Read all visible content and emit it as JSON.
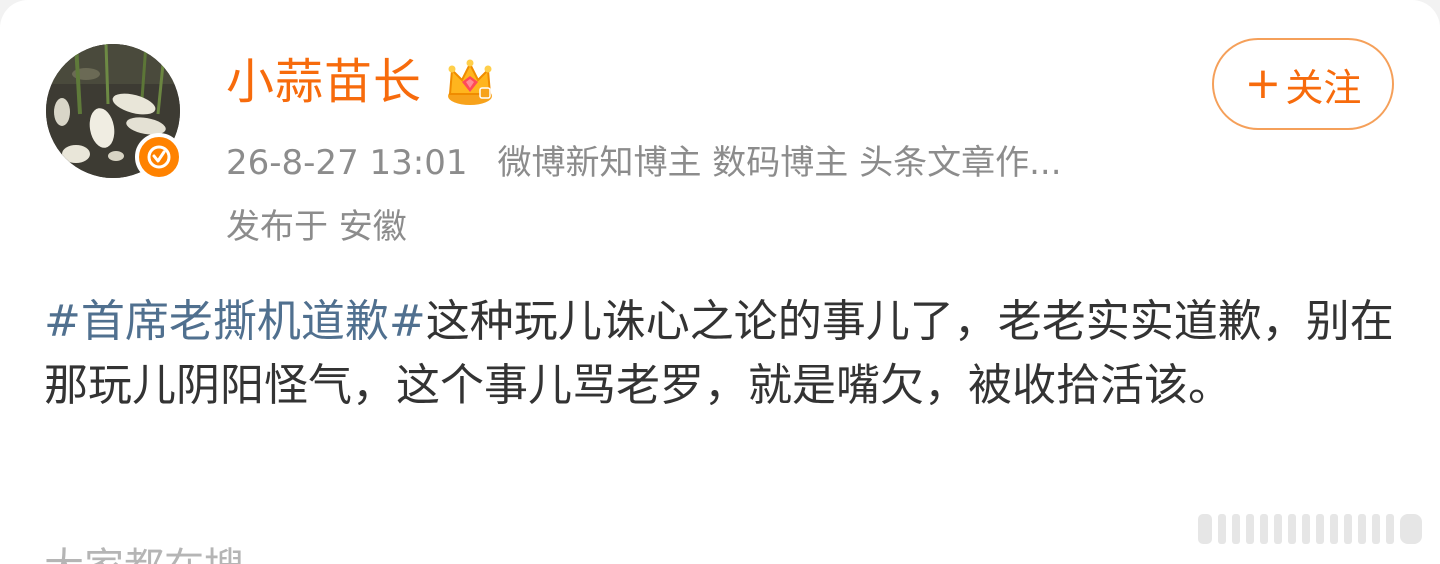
{
  "user": {
    "name": "小蒜苗长",
    "badge_icon": "crown-vip-icon",
    "verified_icon": "verified-check-icon",
    "verified_color": "#ff8200"
  },
  "follow_button": {
    "plus": "+",
    "label": "关注"
  },
  "meta": {
    "timestamp": "26-8-27 13:01",
    "tags": "微博新知博主 数码博主 头条文章作...",
    "location": "发布于 安徽"
  },
  "post": {
    "hashtag": "#首席老撕机道歉#",
    "body": "这种玩儿诛心之论的事儿了，老老实实道歉，别在那玩儿阴阳怪气，这个事儿骂老罗，就是嘴欠，被收拾活该。"
  },
  "cut_off_text": "大家都在搜",
  "colors": {
    "accent": "#f76b0c",
    "hashtag": "#50708f",
    "meta": "#8c8c8c"
  }
}
